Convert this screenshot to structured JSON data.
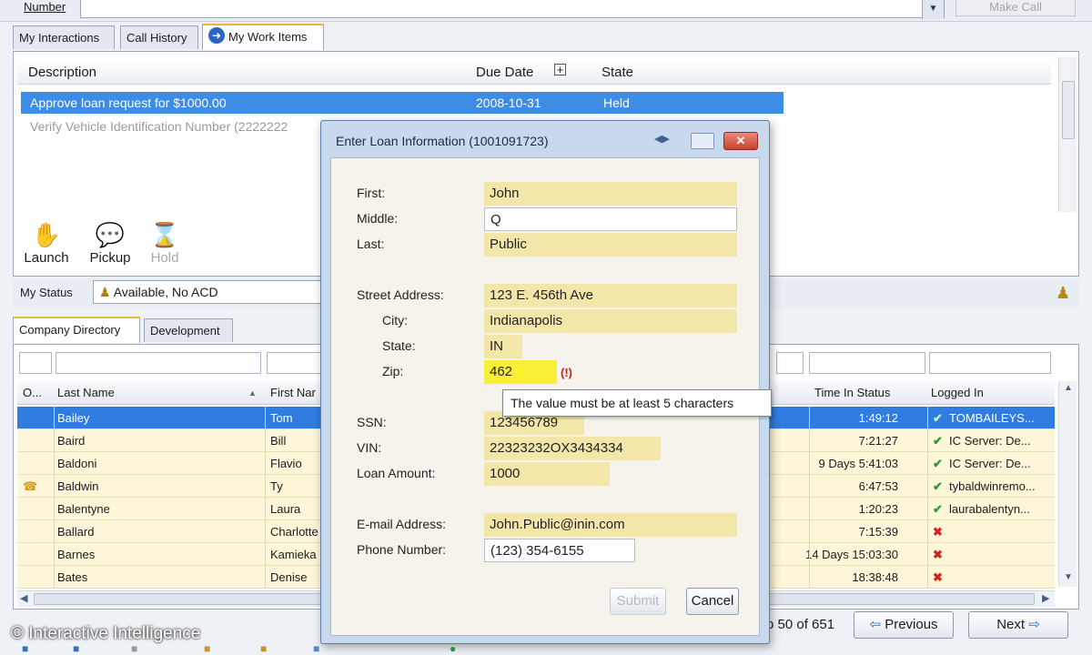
{
  "topbar": {
    "number_label": "Number",
    "number_value": "",
    "make_call": "Make Call"
  },
  "tabs_top": [
    "My Interactions",
    "Call History",
    "My Work Items"
  ],
  "workitems": {
    "headers": {
      "description": "Description",
      "due_date": "Due Date",
      "state": "State"
    },
    "rows": [
      {
        "description": "Approve loan request for $1000.00",
        "due": "2008-10-31",
        "state": "Held"
      },
      {
        "description": "Verify Vehicle Identification Number (2222222",
        "due": "",
        "state": ""
      }
    ],
    "tools": [
      "Launch",
      "Pickup",
      "Hold"
    ]
  },
  "status": {
    "label": "My Status",
    "value": "Available, No ACD"
  },
  "tabs_dir": [
    "Company Directory",
    "Development"
  ],
  "directory": {
    "headers": {
      "o": "O...",
      "last": "Last Name",
      "first": "First Nar",
      "time": "Time In Status",
      "logged": "Logged In"
    },
    "rows": [
      {
        "last": "Bailey",
        "first": "Tom",
        "time": "1:49:12",
        "logged": "TOMBAILEYS...",
        "ok": true
      },
      {
        "last": "Baird",
        "first": "Bill",
        "time": "7:21:27",
        "logged": "IC Server: De...",
        "ok": true
      },
      {
        "last": "Baldoni",
        "first": "Flavio",
        "time": "9 Days 5:41:03",
        "logged": "IC Server: De...",
        "ok": true
      },
      {
        "last": "Baldwin",
        "first": "Ty",
        "time": "6:47:53",
        "logged": "tybaldwinremo...",
        "ok": true
      },
      {
        "last": "Balentyne",
        "first": "Laura",
        "time": "1:20:23",
        "logged": "laurabalentyn...",
        "ok": true
      },
      {
        "last": "Ballard",
        "first": "Charlotte",
        "time": "7:15:39",
        "logged": "",
        "ok": false
      },
      {
        "last": "Barnes",
        "first": "Kamieka",
        "time": "14 Days 15:03:30",
        "logged": "",
        "ok": false
      },
      {
        "last": "Bates",
        "first": "Denise",
        "time": "18:38:48",
        "logged": "",
        "ok": false
      }
    ],
    "page_info": "o 50 of 651",
    "prev": "Previous",
    "next": "Next"
  },
  "modal": {
    "title": "Enter Loan Information (1001091723)",
    "labels": {
      "first": "First:",
      "middle": "Middle:",
      "last": "Last:",
      "street": "Street Address:",
      "city": "City:",
      "state": "State:",
      "zip": "Zip:",
      "ssn": "SSN:",
      "vin": "VIN:",
      "amount": "Loan Amount:",
      "email": "E-mail Address:",
      "phone": "Phone Number:"
    },
    "values": {
      "first": "John",
      "middle": "Q",
      "last": "Public",
      "street": "123 E. 456th Ave",
      "city": "Indianapolis",
      "state": "IN",
      "zip": "462",
      "ssn": "123456789",
      "vin": "22323232OX3434334",
      "amount": "1000",
      "email": "John.Public@inin.com",
      "phone": "(123) 354-6155"
    },
    "zip_error": "(!)",
    "tooltip": "The value must be at least 5 characters",
    "submit": "Submit",
    "cancel": "Cancel"
  },
  "copyright": "© Interactive Intelligence"
}
